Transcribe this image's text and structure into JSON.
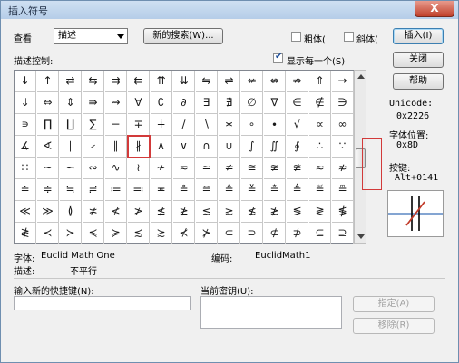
{
  "window": {
    "title": "插入符号",
    "close_label": "X"
  },
  "view": {
    "label": "查看",
    "selected": "描述"
  },
  "top": {
    "new_search": "新的搜索(W)...",
    "bold": "粗体(",
    "italic": "斜体(",
    "insert": "插入(I)"
  },
  "desc_control": "描述控制:",
  "show_each": "显示每一个(S)",
  "buttons": {
    "close": "关闭",
    "help": "帮助",
    "assign": "指定(A)",
    "remove": "移除(R)"
  },
  "info": {
    "unicode_label": "Unicode:",
    "unicode_value": "0x2226",
    "charpos_label": "字体位置:",
    "charpos_value": "0x8D",
    "key_label": "按键:",
    "key_value": "Alt+0141"
  },
  "bottom": {
    "font_label": "字体:",
    "font_value": "Euclid Math One",
    "encoding_label": "编码:",
    "encoding_value": "EuclidMath1",
    "desc_label": "描述:",
    "desc_value": "不平行",
    "new_shortcut_label": "输入新的快捷键(N):",
    "current_key_label": "当前密钥(U):"
  },
  "symbols": [
    [
      "↓",
      "↑",
      "⇄",
      "⇆",
      "⇉",
      "⇇",
      "⇈",
      "⇊",
      "⇋",
      "⇌",
      "⇍",
      "⇎",
      "⇏",
      "⇑",
      "→"
    ],
    [
      "⇓",
      "⇔",
      "⇕",
      "⇛",
      "⇝",
      "∀",
      "∁",
      "∂",
      "∃",
      "∄",
      "∅",
      "∇",
      "∈",
      "∉",
      "∋"
    ],
    [
      "∍",
      "∏",
      "∐",
      "∑",
      "−",
      "∓",
      "∔",
      "∕",
      "∖",
      "∗",
      "∘",
      "∙",
      "√",
      "∝",
      "∞",
      "∟",
      "∠"
    ],
    [
      "∡",
      "∢",
      "∣",
      "∤",
      "∥",
      "∦",
      "∧",
      "∨",
      "∩",
      "∪",
      "∫",
      "∬",
      "∮",
      "∴",
      "∵",
      "∶"
    ],
    [
      "∷",
      "∼",
      "∽",
      "∾",
      "∿",
      "≀",
      "≁",
      "≂",
      "≃",
      "≄",
      "≅",
      "≆",
      "≇",
      "≈",
      "≉"
    ],
    [
      "≐",
      "≑",
      "≒",
      "≓",
      "≔",
      "≕",
      "≖",
      "≗",
      "≘",
      "≙",
      "≚",
      "≛",
      "≜",
      "≝",
      "≞"
    ],
    [
      "≪",
      "≫",
      "≬",
      "≭",
      "≮",
      "≯",
      "≰",
      "≱",
      "≲",
      "≳",
      "≴",
      "≵",
      "≶",
      "≷",
      "≸"
    ],
    [
      "≹",
      "≺",
      "≻",
      "≼",
      "≽",
      "≾",
      "≿",
      "⊀",
      "⊁",
      "⊂",
      "⊃",
      "⊄",
      "⊅",
      "⊆",
      "⊇"
    ]
  ],
  "selected_symbol": {
    "row": 3,
    "col": 5
  }
}
